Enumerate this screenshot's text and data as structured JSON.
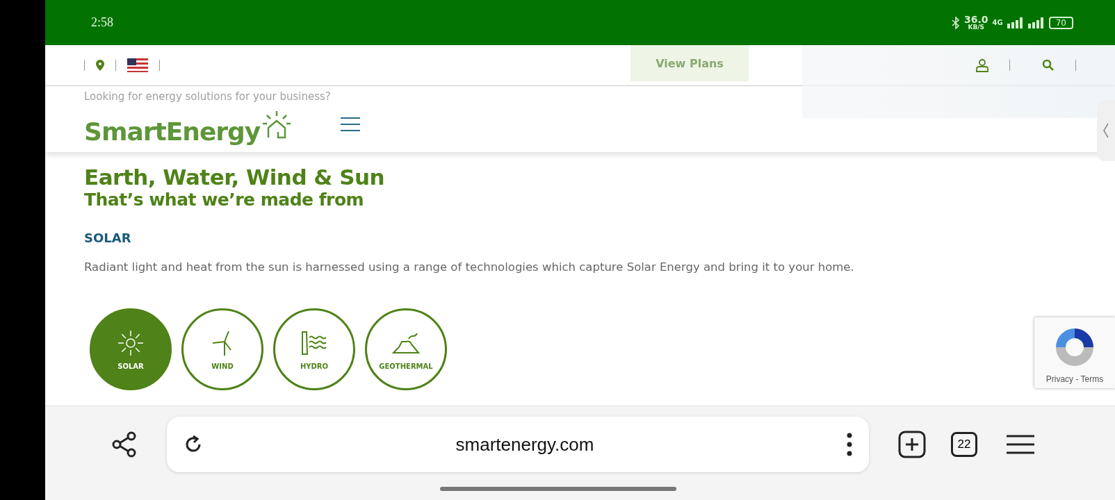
{
  "status_bar": {
    "time": "2:58",
    "speed": "36.0",
    "speed_unit": "KB/S",
    "network": "4G",
    "battery": "70"
  },
  "header": {
    "faded_button": "View Plans",
    "faded_text": "Looking for energy solutions for your business?",
    "logo": "SmartEnergy"
  },
  "hero": {
    "title": "Earth, Water, Wind & Sun",
    "subtitle": "That’s what we’re made from"
  },
  "section": {
    "heading": "SOLAR",
    "description": "Radiant light and heat from the sun is harnessed using a range of technologies which capture Solar Energy and bring it to your home."
  },
  "energy_tabs": [
    {
      "kind": "solar",
      "label": "SOLAR",
      "selected": true
    },
    {
      "kind": "wind",
      "label": "WIND",
      "selected": false
    },
    {
      "kind": "hydro",
      "label": "HYDRO",
      "selected": false
    },
    {
      "kind": "geothermal",
      "label": "GEOTHERMAL",
      "selected": false
    }
  ],
  "recaptcha": {
    "text": "Privacy - Terms"
  },
  "browser": {
    "url": "smartenergy.com",
    "tab_count": "22"
  }
}
